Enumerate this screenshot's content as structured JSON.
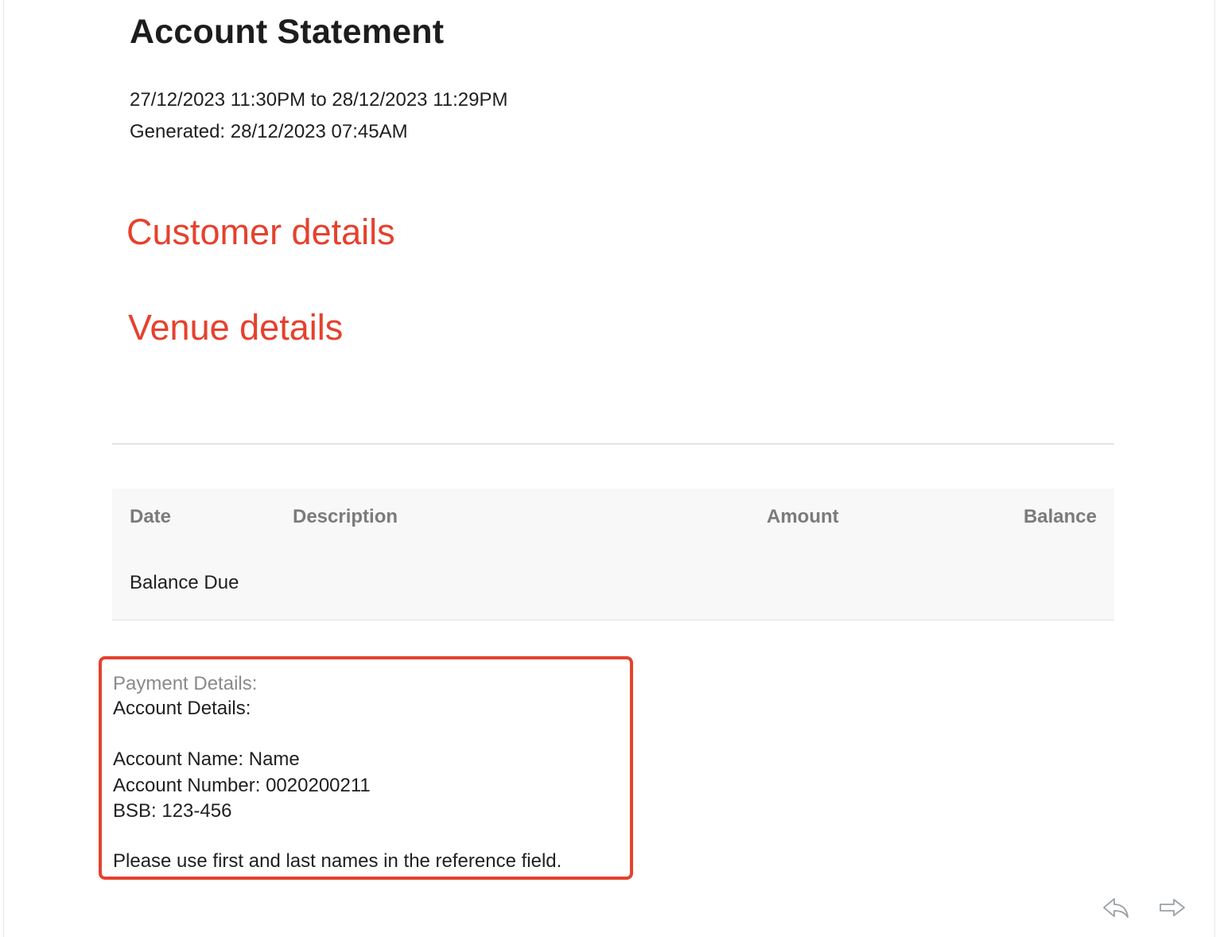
{
  "statement": {
    "title": "Account Statement",
    "period": "27/12/2023 11:30PM to 28/12/2023 11:29PM",
    "generated": "Generated: 28/12/2023 07:45AM"
  },
  "sections": {
    "customer_heading": "Customer details",
    "venue_heading": "Venue details"
  },
  "table": {
    "headers": [
      "Date",
      "Description",
      "Amount",
      "Balance"
    ],
    "rows": [
      {
        "date": "Balance Due",
        "description": "",
        "amount": "",
        "balance": ""
      }
    ]
  },
  "payment": {
    "label": "Payment Details:",
    "account_details": "Account Details:",
    "account_name": "Account Name: Name",
    "account_number": "Account Number: 0020200211",
    "bsb": "BSB: 123-456",
    "note": "Please use first and last names in the reference field."
  },
  "icons": {
    "reply": "reply-icon",
    "forward": "forward-icon"
  },
  "colors": {
    "accent": "#e5412d",
    "header_text": "#7b7b7b",
    "table_bg": "#f8f8f8"
  }
}
